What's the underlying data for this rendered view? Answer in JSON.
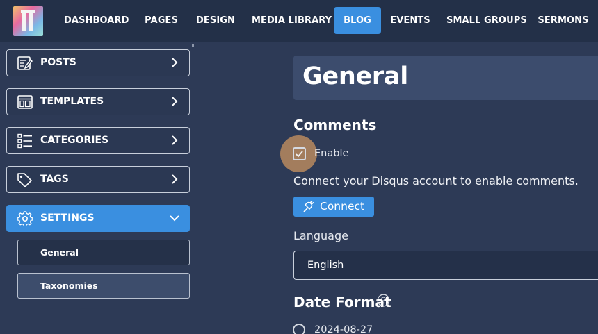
{
  "nav": {
    "items": [
      {
        "label": "DASHBOARD",
        "active": false
      },
      {
        "label": "PAGES",
        "active": false
      },
      {
        "label": "DESIGN",
        "active": false
      },
      {
        "label": "MEDIA LIBRARY",
        "active": false
      },
      {
        "label": "BLOG",
        "active": true
      },
      {
        "label": "EVENTS",
        "active": false
      },
      {
        "label": "SMALL GROUPS",
        "active": false
      },
      {
        "label": "SERMONS",
        "active": false
      }
    ]
  },
  "sidebar": {
    "items": [
      {
        "label": "POSTS",
        "icon": "posts-icon"
      },
      {
        "label": "TEMPLATES",
        "icon": "templates-icon"
      },
      {
        "label": "CATEGORIES",
        "icon": "categories-icon"
      },
      {
        "label": "TAGS",
        "icon": "tag-icon"
      },
      {
        "label": "SETTINGS",
        "icon": "gear-icon",
        "expanded": true
      }
    ],
    "subitems": [
      {
        "label": "General",
        "current": true
      },
      {
        "label": "Taxonomies",
        "current": false
      }
    ]
  },
  "main": {
    "title": "General",
    "comments": {
      "heading": "Comments",
      "enable_label": "Enable",
      "enabled": true,
      "help": "Connect your Disqus account to enable comments.",
      "connect_label": "Connect"
    },
    "language": {
      "label": "Language",
      "value": "English"
    },
    "date_format": {
      "heading": "Date Format",
      "options": [
        "2024-08-27"
      ]
    }
  },
  "colors": {
    "accent": "#3a8fe0",
    "background": "#2d3a56",
    "topbar": "#233048",
    "focus_ring": "#b88a5e"
  }
}
